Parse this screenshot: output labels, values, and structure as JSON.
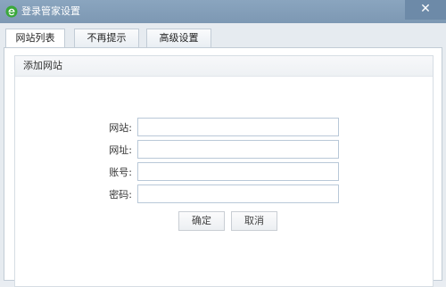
{
  "window": {
    "title": "登录管家设置",
    "close_glyph": "✕",
    "app_icon": "ie-logo-icon",
    "app_icon_color": "#3aa83a"
  },
  "tabs": [
    {
      "label": "网站列表",
      "active": true
    },
    {
      "label": "不再提示",
      "active": false
    },
    {
      "label": "高级设置",
      "active": false
    }
  ],
  "group": {
    "title": "添加网站"
  },
  "form": {
    "fields": [
      {
        "label": "网站:",
        "value": "",
        "placeholder": ""
      },
      {
        "label": "网址:",
        "value": "",
        "placeholder": ""
      },
      {
        "label": "账号:",
        "value": "",
        "placeholder": ""
      },
      {
        "label": "密码:",
        "value": "",
        "placeholder": ""
      }
    ],
    "ok_label": "确定",
    "cancel_label": "取消"
  },
  "colors": {
    "titlebar": "#7d98b3",
    "field_border": "#b9c8d8",
    "panel_bg": "#ffffff"
  }
}
